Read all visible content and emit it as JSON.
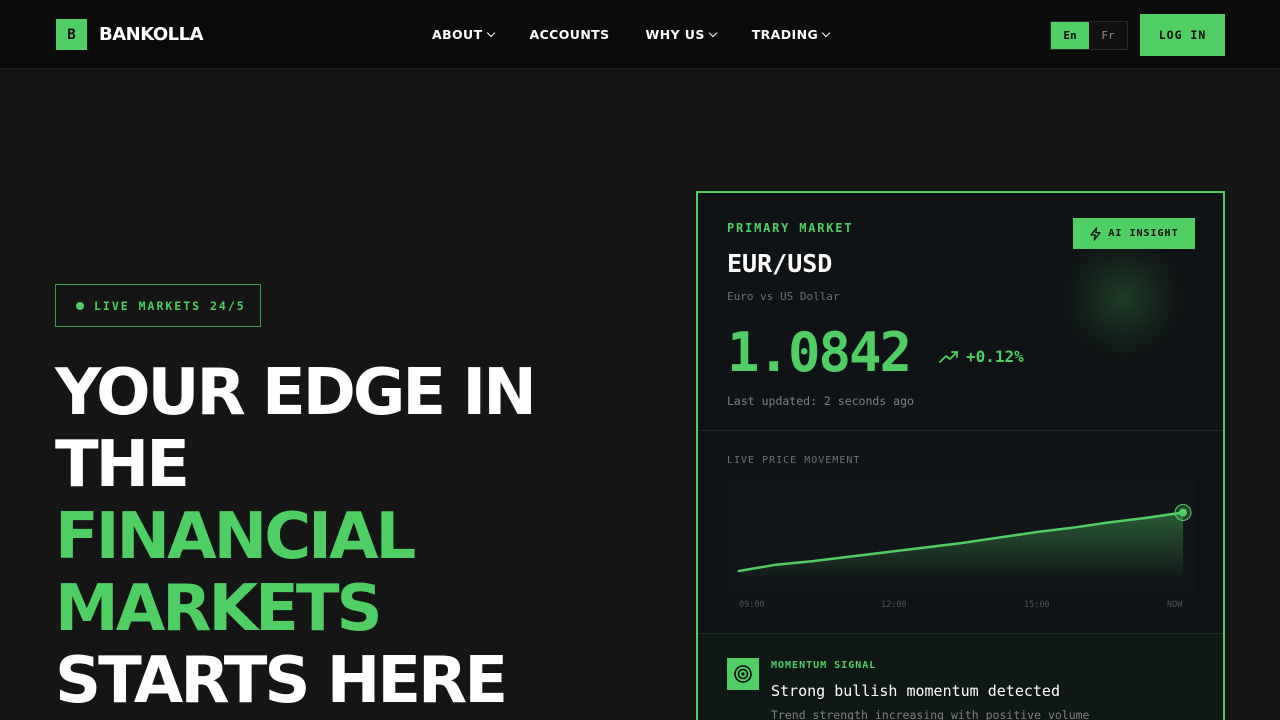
{
  "brand": {
    "mark": "B",
    "name": "BANKOLLA"
  },
  "nav": {
    "items": [
      {
        "label": "ABOUT",
        "has_dropdown": true
      },
      {
        "label": "ACCOUNTS",
        "has_dropdown": false
      },
      {
        "label": "WHY US",
        "has_dropdown": true
      },
      {
        "label": "TRADING",
        "has_dropdown": true
      }
    ]
  },
  "language": {
    "options": [
      "En",
      "Fr"
    ],
    "selected": "En"
  },
  "header": {
    "login_label": "LOG IN"
  },
  "hero": {
    "badge": "LIVE MARKETS 24/5",
    "headline_white_1": "YOUR EDGE IN",
    "headline_white_2": "THE",
    "headline_green_1": "FINANCIAL",
    "headline_green_2": "MARKETS",
    "headline_white_3": "STARTS HERE"
  },
  "market_card": {
    "label": "PRIMARY MARKET",
    "ai_button": "AI INSIGHT",
    "pair": "EUR/USD",
    "pair_desc": "Euro vs US Dollar",
    "price": "1.0842",
    "change": "+0.12%",
    "updated": "Last updated: 2 seconds ago",
    "chart_label": "LIVE PRICE MOVEMENT",
    "signal_label": "MOMENTUM SIGNAL",
    "signal_title": "Strong bullish momentum detected",
    "signal_sub": "Trend strength increasing with positive volume"
  },
  "chart_data": {
    "type": "area",
    "categories": [
      "09:00",
      "12:00",
      "15:00",
      "NOW"
    ],
    "x": [
      0,
      1,
      2,
      3,
      4,
      5,
      6,
      7,
      8,
      9,
      10,
      11,
      12
    ],
    "series": [
      {
        "values": [
          0.1,
          0.17,
          0.21,
          0.26,
          0.31,
          0.36,
          0.41,
          0.47,
          0.53,
          0.58,
          0.64,
          0.69,
          0.75
        ]
      }
    ],
    "ylim": [
      0,
      1
    ],
    "grid": false,
    "colors": {
      "line": "#4fce63",
      "fill": "#4fce63"
    }
  },
  "colors": {
    "accent": "#4fce63",
    "background": "#151515",
    "header": "#0b0b0b"
  }
}
